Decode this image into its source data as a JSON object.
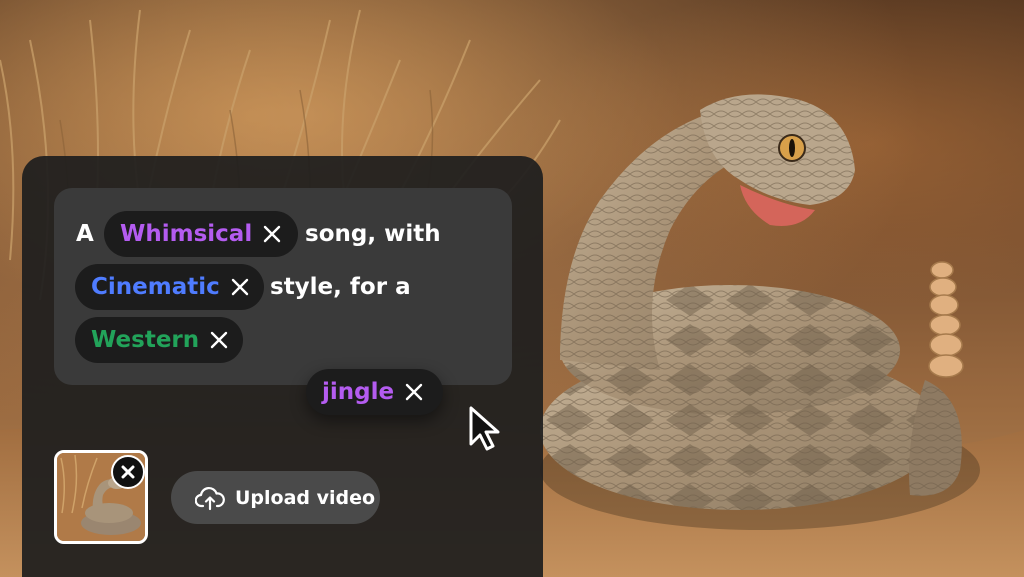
{
  "prompt": {
    "segments": [
      {
        "kind": "word",
        "text": "A"
      },
      {
        "kind": "tag",
        "text": "Whimsical",
        "color": "#b45cf0"
      },
      {
        "kind": "word",
        "text": "song, with"
      },
      {
        "kind": "tag",
        "text": "Cinematic",
        "color": "#4f7cff"
      },
      {
        "kind": "word",
        "text": "style, for a"
      },
      {
        "kind": "tag",
        "text": "Western",
        "color": "#22a35a"
      }
    ],
    "dragged_tag": {
      "text": "jingle",
      "color": "#b45cf0"
    }
  },
  "media": {
    "thumbnail_alt": "rattlesnake video thumbnail",
    "upload_label": "Upload video"
  },
  "icons": {
    "remove_tag": "close-x-icon",
    "remove_media": "close-circle-icon",
    "upload": "cloud-upload-icon",
    "cursor": "arrow-pointer-icon"
  },
  "colors": {
    "panel": "#1e1e1e",
    "prompt_box": "#3a3a3a",
    "tag_background": "#1c1c1c",
    "upload_button": "#4a4a4a"
  }
}
